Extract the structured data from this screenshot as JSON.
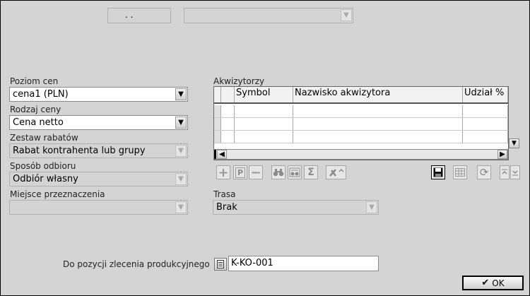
{
  "top": {
    "date_value": ". .",
    "combo_value": ""
  },
  "form": {
    "price_level": {
      "label": "Poziom cen",
      "value": "cena1 (PLN)"
    },
    "price_type": {
      "label": "Rodzaj ceny",
      "value": "Cena netto"
    },
    "discount_set": {
      "label": "Zestaw rabatów",
      "value": "Rabat kontrahenta lub grupy"
    },
    "pickup_method": {
      "label": "Sposób odbioru",
      "value": "Odbiór własny"
    },
    "destination": {
      "label": "Miejsce przeznaczenia",
      "value": ""
    },
    "route": {
      "label": "Trasa",
      "value": "Brak"
    },
    "production_order": {
      "label": "Do pozycji zlecenia produkcyjnego",
      "value": "K-KO-001"
    }
  },
  "acquirers": {
    "label": "Akwizytorzy",
    "columns": [
      "Symbol",
      "Nazwisko akwizytora",
      "Udział %"
    ]
  },
  "toolbar": {
    "add": "+",
    "p": "P",
    "remove": "−",
    "sum": "Σ"
  },
  "ok": {
    "label": "OK",
    "icon": "✔"
  }
}
